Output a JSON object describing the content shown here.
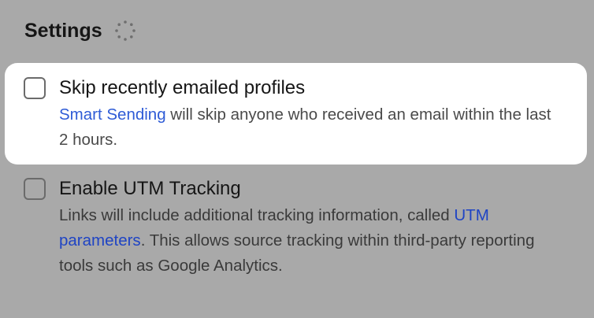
{
  "header": {
    "title": "Settings"
  },
  "options": [
    {
      "label": "Skip recently emailed profiles",
      "checked": false,
      "desc_link": "Smart Sending",
      "desc_text": " will skip anyone who received an email within the last 2 hours."
    },
    {
      "label": "Enable UTM Tracking",
      "checked": false,
      "desc_pre": "Links will include additional tracking information, called ",
      "desc_link": "UTM parameters",
      "desc_post": ". This allows source tracking within third-party reporting tools such as Google Analytics."
    }
  ],
  "icons": {
    "spinner": "loading-spinner-icon"
  },
  "colors": {
    "background": "#a9a9a9",
    "card": "#ffffff",
    "link": "#2e5bd6"
  }
}
